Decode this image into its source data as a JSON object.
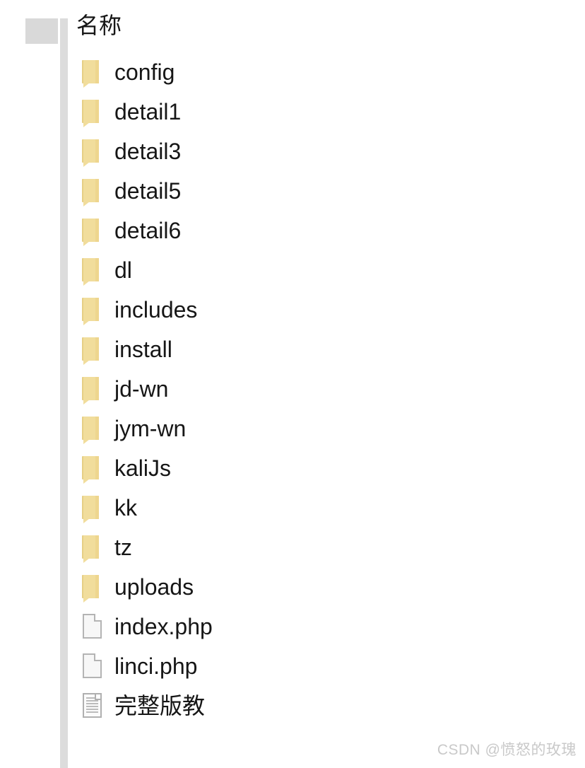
{
  "window": {
    "background_color": "#ffffff",
    "text_color": "#161616"
  },
  "navigation_pane": {
    "placeholder_label": "",
    "divider_color": "#dcdcdc"
  },
  "file_pane": {
    "column_header": "名称",
    "folder_icon_color": "#f1dd9c",
    "file_icon_color": "#f7f7f7",
    "items": [
      {
        "name": "config",
        "icon": "folder-icon",
        "type": "folder"
      },
      {
        "name": "detail1",
        "icon": "folder-icon",
        "type": "folder"
      },
      {
        "name": "detail3",
        "icon": "folder-icon",
        "type": "folder"
      },
      {
        "name": "detail5",
        "icon": "folder-icon",
        "type": "folder"
      },
      {
        "name": "detail6",
        "icon": "folder-icon",
        "type": "folder"
      },
      {
        "name": "dl",
        "icon": "folder-icon",
        "type": "folder"
      },
      {
        "name": "includes",
        "icon": "folder-icon",
        "type": "folder"
      },
      {
        "name": "install",
        "icon": "folder-icon",
        "type": "folder"
      },
      {
        "name": "jd-wn",
        "icon": "folder-icon",
        "type": "folder"
      },
      {
        "name": "jym-wn",
        "icon": "folder-icon",
        "type": "folder"
      },
      {
        "name": "kaliJs",
        "icon": "folder-icon",
        "type": "folder"
      },
      {
        "name": "kk",
        "icon": "folder-icon",
        "type": "folder"
      },
      {
        "name": "tz",
        "icon": "folder-icon",
        "type": "folder"
      },
      {
        "name": "uploads",
        "icon": "folder-icon",
        "type": "folder"
      },
      {
        "name": "index.php",
        "icon": "file-blank-icon",
        "type": "file"
      },
      {
        "name": "linci.php",
        "icon": "file-blank-icon",
        "type": "file"
      },
      {
        "name": "完整版教",
        "icon": "file-document-icon",
        "type": "file"
      }
    ]
  },
  "scrollbar": {
    "thumb_color": "#7b7b7b",
    "orientation": "vertical"
  },
  "watermark": {
    "text": "CSDN @愤怒的玫瑰",
    "color": "#c9c9c9"
  }
}
